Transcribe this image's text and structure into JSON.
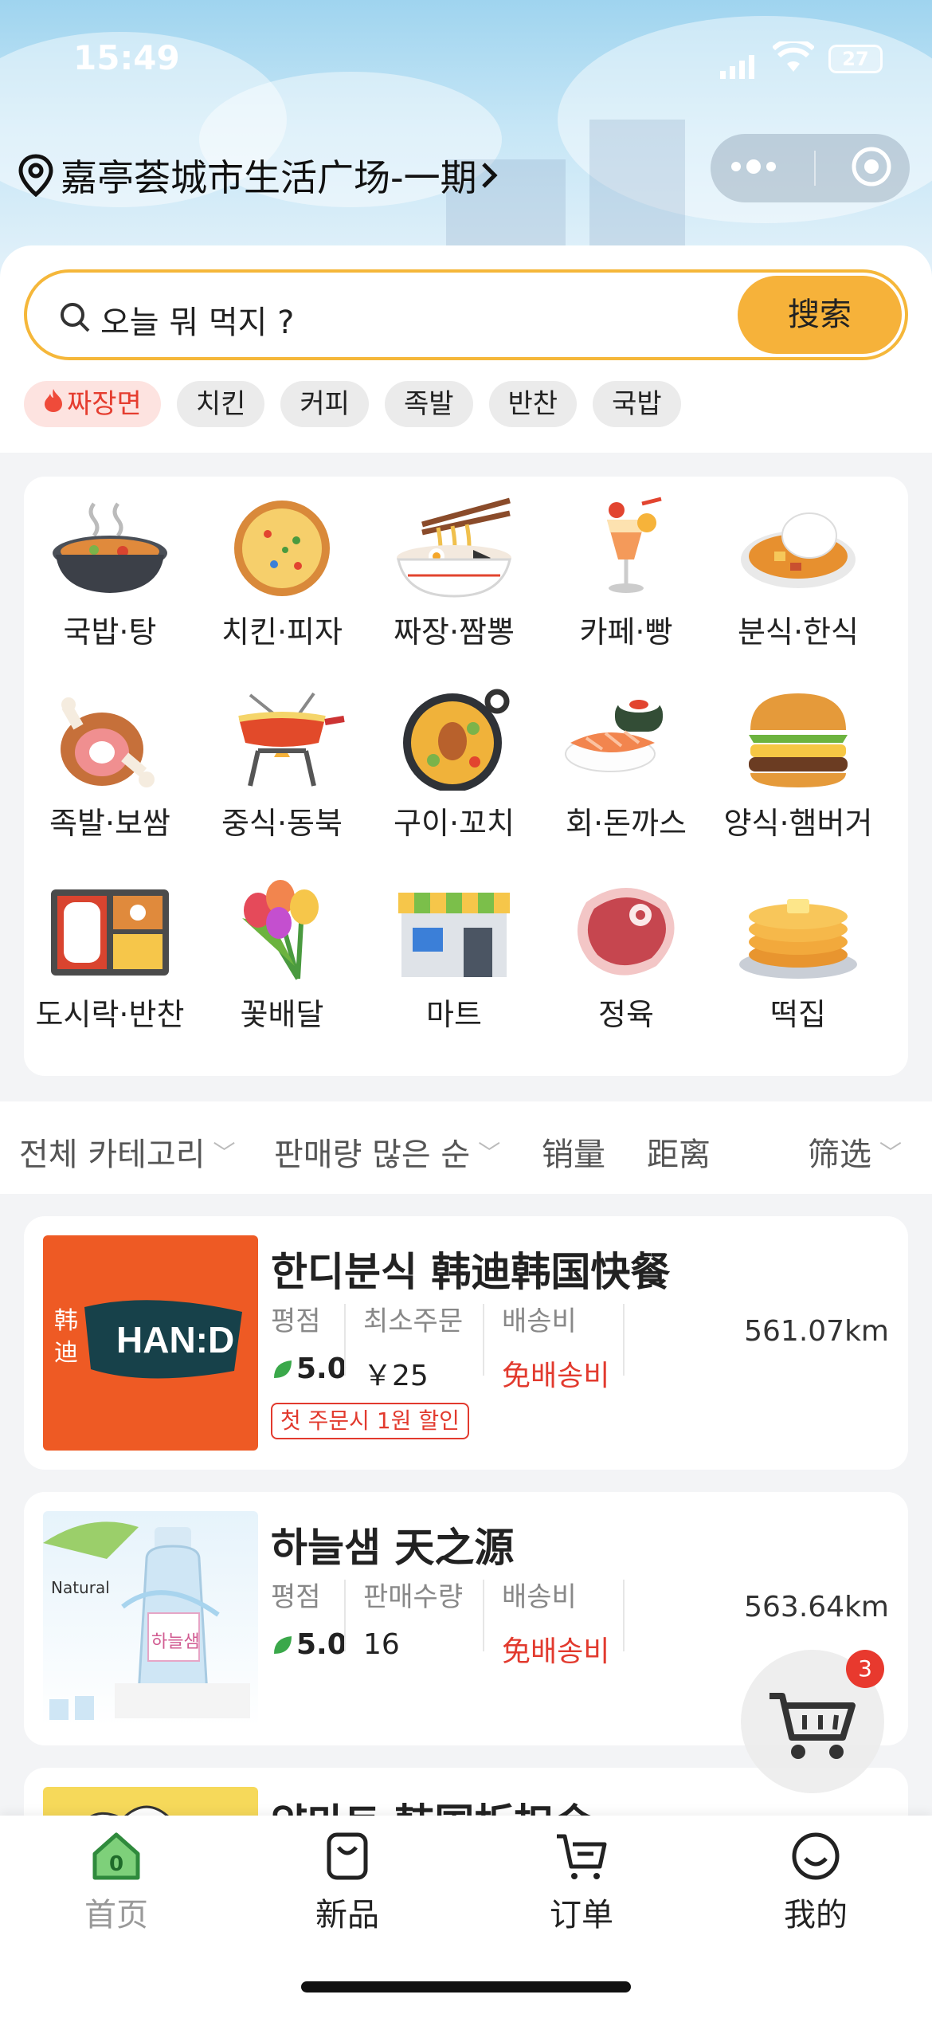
{
  "status_bar": {
    "time": "15:49",
    "battery": "27",
    "signal_icon": "signal-icon",
    "wifi_icon": "wifi-icon"
  },
  "header": {
    "location": "嘉亭荟城市生活广场-一期",
    "more_icon": "more-dots-icon",
    "close_icon": "target-circle-icon"
  },
  "search": {
    "placeholder": "오늘 뭐 먹지 ?",
    "button": "搜索"
  },
  "hot_tags": [
    "짜장면",
    "치킨",
    "커피",
    "족발",
    "반찬",
    "국밥"
  ],
  "categories": [
    {
      "label": "국밥·탕",
      "icon": "hotpot-icon"
    },
    {
      "label": "치킨·피자",
      "icon": "pizza-icon"
    },
    {
      "label": "짜장·짬뽕",
      "icon": "noodle-bowl-icon"
    },
    {
      "label": "카페·빵",
      "icon": "cocktail-icon"
    },
    {
      "label": "분식·한식",
      "icon": "curry-rice-icon"
    },
    {
      "label": "족발·보쌈",
      "icon": "meat-leg-icon"
    },
    {
      "label": "중식·동북",
      "icon": "fondue-icon"
    },
    {
      "label": "구이·꼬치",
      "icon": "paella-pan-icon"
    },
    {
      "label": "회·돈까스",
      "icon": "sushi-icon"
    },
    {
      "label": "양식·햄버거",
      "icon": "burger-icon"
    },
    {
      "label": "도시락·반찬",
      "icon": "bento-icon"
    },
    {
      "label": "꽃배달",
      "icon": "flower-bouquet-icon"
    },
    {
      "label": "마트",
      "icon": "store-icon"
    },
    {
      "label": "정육",
      "icon": "steak-icon"
    },
    {
      "label": "떡집",
      "icon": "pancake-icon"
    }
  ],
  "filters": {
    "category": "전체 카테고리",
    "sort": "판매량 많은 순",
    "sales": "销量",
    "distance": "距离",
    "filter": "筛选"
  },
  "stores": [
    {
      "name": "한디분식 韩迪韩国快餐",
      "col1_header": "평점",
      "rating": "5.0",
      "col2_header": "최소주문",
      "col2_value": "￥25",
      "col3_header": "배송비",
      "col3_value": "免배송비",
      "distance": "561.07km",
      "promo": "첫 주문시 1원 할인",
      "logo_text": "HAN:D",
      "logo_chinese": "韩迪"
    },
    {
      "name": "하늘샘 天之源",
      "col1_header": "평점",
      "rating": "5.0",
      "col2_header": "판매수량",
      "col2_value": "16",
      "col3_header": "배송비",
      "col3_value": "免배송비",
      "distance": "563.64km",
      "thumb_text": "Natural",
      "bottle_text": "하늘샘"
    },
    {
      "name": "얌마트 韩国折扣会"
    }
  ],
  "cart": {
    "count": "3"
  },
  "tabbar": [
    {
      "label": "首页",
      "icon": "home-icon",
      "active": true,
      "badge": "0"
    },
    {
      "label": "新品",
      "icon": "bag-icon"
    },
    {
      "label": "订单",
      "icon": "cart-list-icon"
    },
    {
      "label": "我的",
      "icon": "smile-icon"
    }
  ],
  "colors": {
    "accent": "#f6b23a",
    "red": "#e23a2e",
    "green": "#3aa84a"
  }
}
